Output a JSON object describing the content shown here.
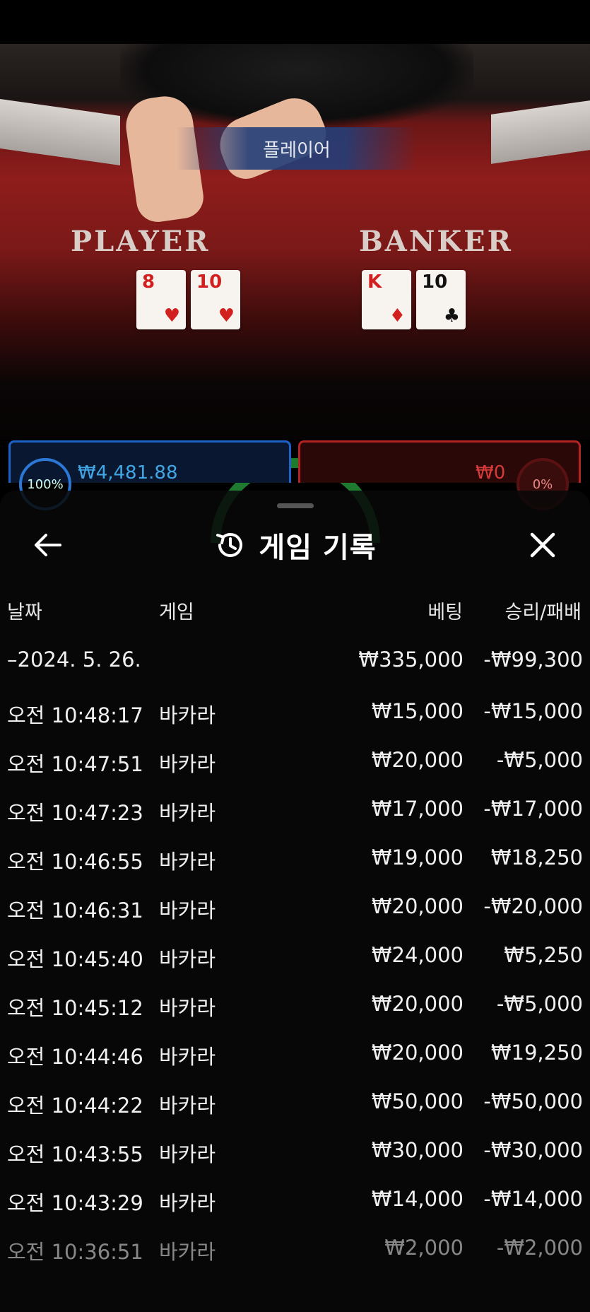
{
  "scene": {
    "result_banner": "플레이어",
    "player_label": "PLAYER",
    "banker_label": "BANKER",
    "cards": [
      {
        "rank": "8",
        "suit": "♥",
        "color": "red"
      },
      {
        "rank": "10",
        "suit": "♥",
        "color": "red"
      },
      {
        "rank": "K",
        "suit": "♦",
        "color": "red"
      },
      {
        "rank": "10",
        "suit": "♣",
        "color": "black"
      }
    ],
    "player_bet": {
      "pct": "100%",
      "amount": "₩4,481.88"
    },
    "banker_bet": {
      "pct": "0%",
      "amount": "₩0"
    }
  },
  "sheet": {
    "title": "게임 기록",
    "back_icon": "arrow-left-icon",
    "history_icon": "history-icon",
    "close_icon": "close-icon",
    "columns": {
      "date": "날짜",
      "game": "게임",
      "bet": "베팅",
      "result": "승리/패배"
    },
    "summary": {
      "date": "–2024. 5. 26.",
      "bet": "₩335,000",
      "result": "-₩99,300"
    },
    "rows": [
      {
        "time": "오전 10:48:17",
        "game": "바카라",
        "bet": "₩15,000",
        "result": "-₩15,000"
      },
      {
        "time": "오전 10:47:51",
        "game": "바카라",
        "bet": "₩20,000",
        "result": "-₩5,000"
      },
      {
        "time": "오전 10:47:23",
        "game": "바카라",
        "bet": "₩17,000",
        "result": "-₩17,000"
      },
      {
        "time": "오전 10:46:55",
        "game": "바카라",
        "bet": "₩19,000",
        "result": "₩18,250"
      },
      {
        "time": "오전 10:46:31",
        "game": "바카라",
        "bet": "₩20,000",
        "result": "-₩20,000"
      },
      {
        "time": "오전 10:45:40",
        "game": "바카라",
        "bet": "₩24,000",
        "result": "₩5,250"
      },
      {
        "time": "오전 10:45:12",
        "game": "바카라",
        "bet": "₩20,000",
        "result": "-₩5,000"
      },
      {
        "time": "오전 10:44:46",
        "game": "바카라",
        "bet": "₩20,000",
        "result": "₩19,250"
      },
      {
        "time": "오전 10:44:22",
        "game": "바카라",
        "bet": "₩50,000",
        "result": "-₩50,000"
      },
      {
        "time": "오전 10:43:55",
        "game": "바카라",
        "bet": "₩30,000",
        "result": "-₩30,000"
      },
      {
        "time": "오전 10:43:29",
        "game": "바카라",
        "bet": "₩14,000",
        "result": "-₩14,000"
      },
      {
        "time": "오전 10:36:51",
        "game": "바카라",
        "bet": "₩2,000",
        "result": "-₩2,000"
      }
    ]
  }
}
